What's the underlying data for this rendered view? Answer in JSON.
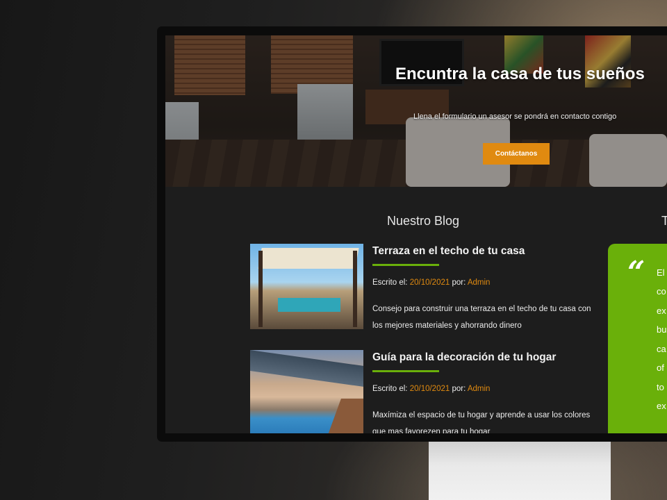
{
  "hero": {
    "title": "Encuntra la casa de tus sueños",
    "subtitle": "Llena el formulario un asesor se pondrá en contacto contigo",
    "cta_label": "Contáctanos"
  },
  "blog": {
    "section_title": "Nuestro Blog",
    "posts": [
      {
        "title": "Terraza en el techo de tu casa",
        "written_label": "Escrito el:",
        "date": "20/10/2021",
        "by_label": "por:",
        "author": "Admin",
        "excerpt": "Consejo para construir una terraza en el techo de tu casa con los mejores materiales y ahorrando dinero"
      },
      {
        "title": "Guía para la decoración de tu hogar",
        "written_label": "Escrito el:",
        "date": "20/10/2021",
        "by_label": "por:",
        "author": "Admin",
        "excerpt": "Maxímiza el espacio de tu hogar y aprende a usar los colores que mas favorezen para tu hogar"
      }
    ]
  },
  "testimonials": {
    "section_title_visible": "T",
    "quote_icon": "quote-icon",
    "lines": [
      "El",
      "co",
      "ex",
      "bu",
      "ca",
      "of",
      "to",
      "ex"
    ]
  },
  "colors": {
    "accent_orange": "#e08a10",
    "accent_green": "#6ab00a",
    "page_bg": "#1d1d1d"
  }
}
